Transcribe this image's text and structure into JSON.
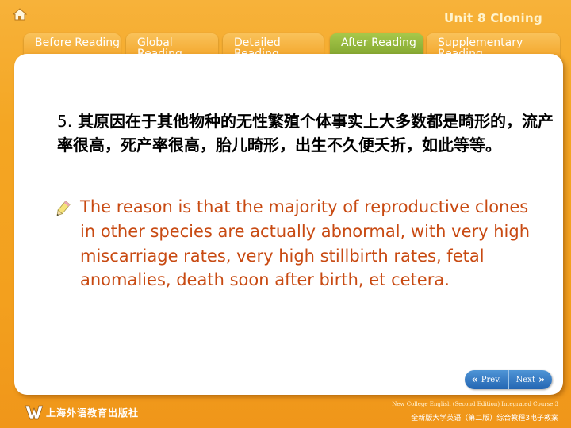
{
  "header": {
    "unit_title": "Unit 8 Cloning"
  },
  "tabs": [
    {
      "label": "Before Reading",
      "active": false
    },
    {
      "label": "Global Reading",
      "active": false
    },
    {
      "label": "Detailed Reading",
      "active": false
    },
    {
      "label": "After Reading",
      "active": true
    },
    {
      "label": "Supplementary Reading",
      "active": false
    }
  ],
  "content": {
    "number": "5.",
    "chinese": "其原因在于其他物种的无性繁殖个体事实上大多数都是畸形的，流产率很高，死产率很高，胎儿畸形，出生不久便夭折，如此等等。",
    "english": "The reason is that the majority of reproductive clones in other species are actually abnormal, with very high miscarriage rates, very high stillbirth rates, fetal anomalies, death soon after birth, et cetera."
  },
  "nav": {
    "prev_label": "Prev.",
    "next_label": "Next"
  },
  "footer": {
    "publisher": "上海外语教育出版社",
    "english_line": "New College English (Second Edition) Integrated Course 3",
    "chinese_line": "全新版大学英语（第二版）综合教程3电子教案"
  },
  "colors": {
    "background": "#f4a623",
    "active_tab": "#8cb034",
    "english_text": "#c84a12",
    "nav_button": "#2f76c2"
  },
  "icons": [
    "home-icon",
    "pencil-icon",
    "prev-arrow-icon",
    "next-arrow-icon",
    "publisher-logo"
  ]
}
